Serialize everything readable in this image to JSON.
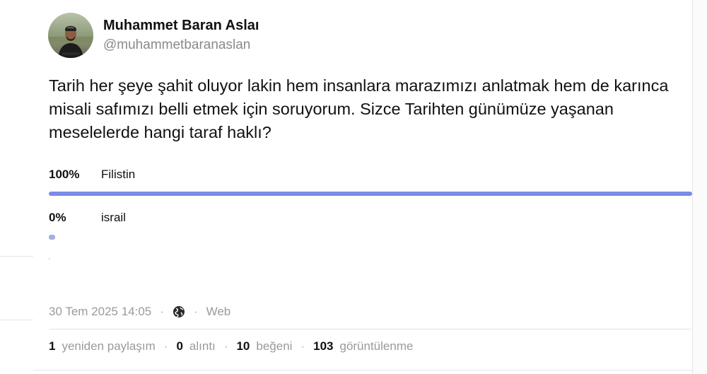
{
  "author": {
    "display_name": "Muhammet Baran Aslaı",
    "handle": "@muhammetbaranaslan"
  },
  "tweet": {
    "text": "Tarih her şeye şahit oluyor lakin hem insanlara marazımızı anlatmak hem de karınca misali safımızı belli etmek için soruyorum. Sizce Tarihten günümüze yaşanan meselelerde hangi taraf haklı?"
  },
  "poll": {
    "options": [
      {
        "percent_label": "100%",
        "label": "Filistin",
        "value": 1.0
      },
      {
        "percent_label": "0%",
        "label": "israil",
        "value": 0.0
      }
    ],
    "bar_color": "#7b8be6"
  },
  "meta": {
    "date": "30 Tem 2025 14:05",
    "sep": "·",
    "globe_icon": "globe-icon",
    "source": "Web"
  },
  "stats": {
    "reposts": {
      "count": "1",
      "label": "yeniden paylaşım"
    },
    "quotes": {
      "count": "0",
      "label": "alıntı"
    },
    "likes": {
      "count": "10",
      "label": "beğeni"
    },
    "views": {
      "count": "103",
      "label": "görüntülenme"
    },
    "sep": "·"
  }
}
